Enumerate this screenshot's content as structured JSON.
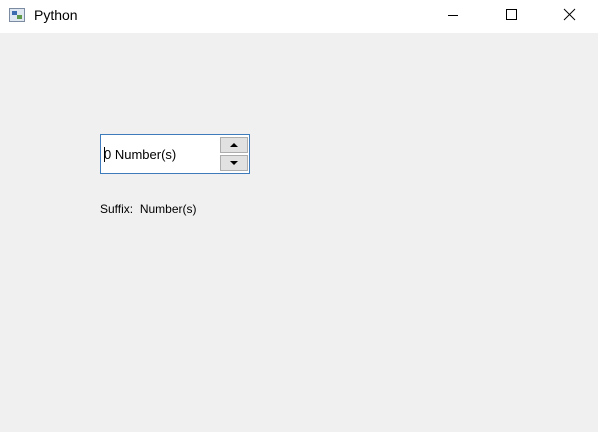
{
  "window": {
    "title": "Python",
    "icon": "python-app-icon",
    "controls": [
      "minimize-icon",
      "maximize-icon",
      "close-icon"
    ]
  },
  "spinbox": {
    "value": "0 Number(s)"
  },
  "suffix": {
    "label": "Suffix:",
    "value": "Number(s)"
  }
}
